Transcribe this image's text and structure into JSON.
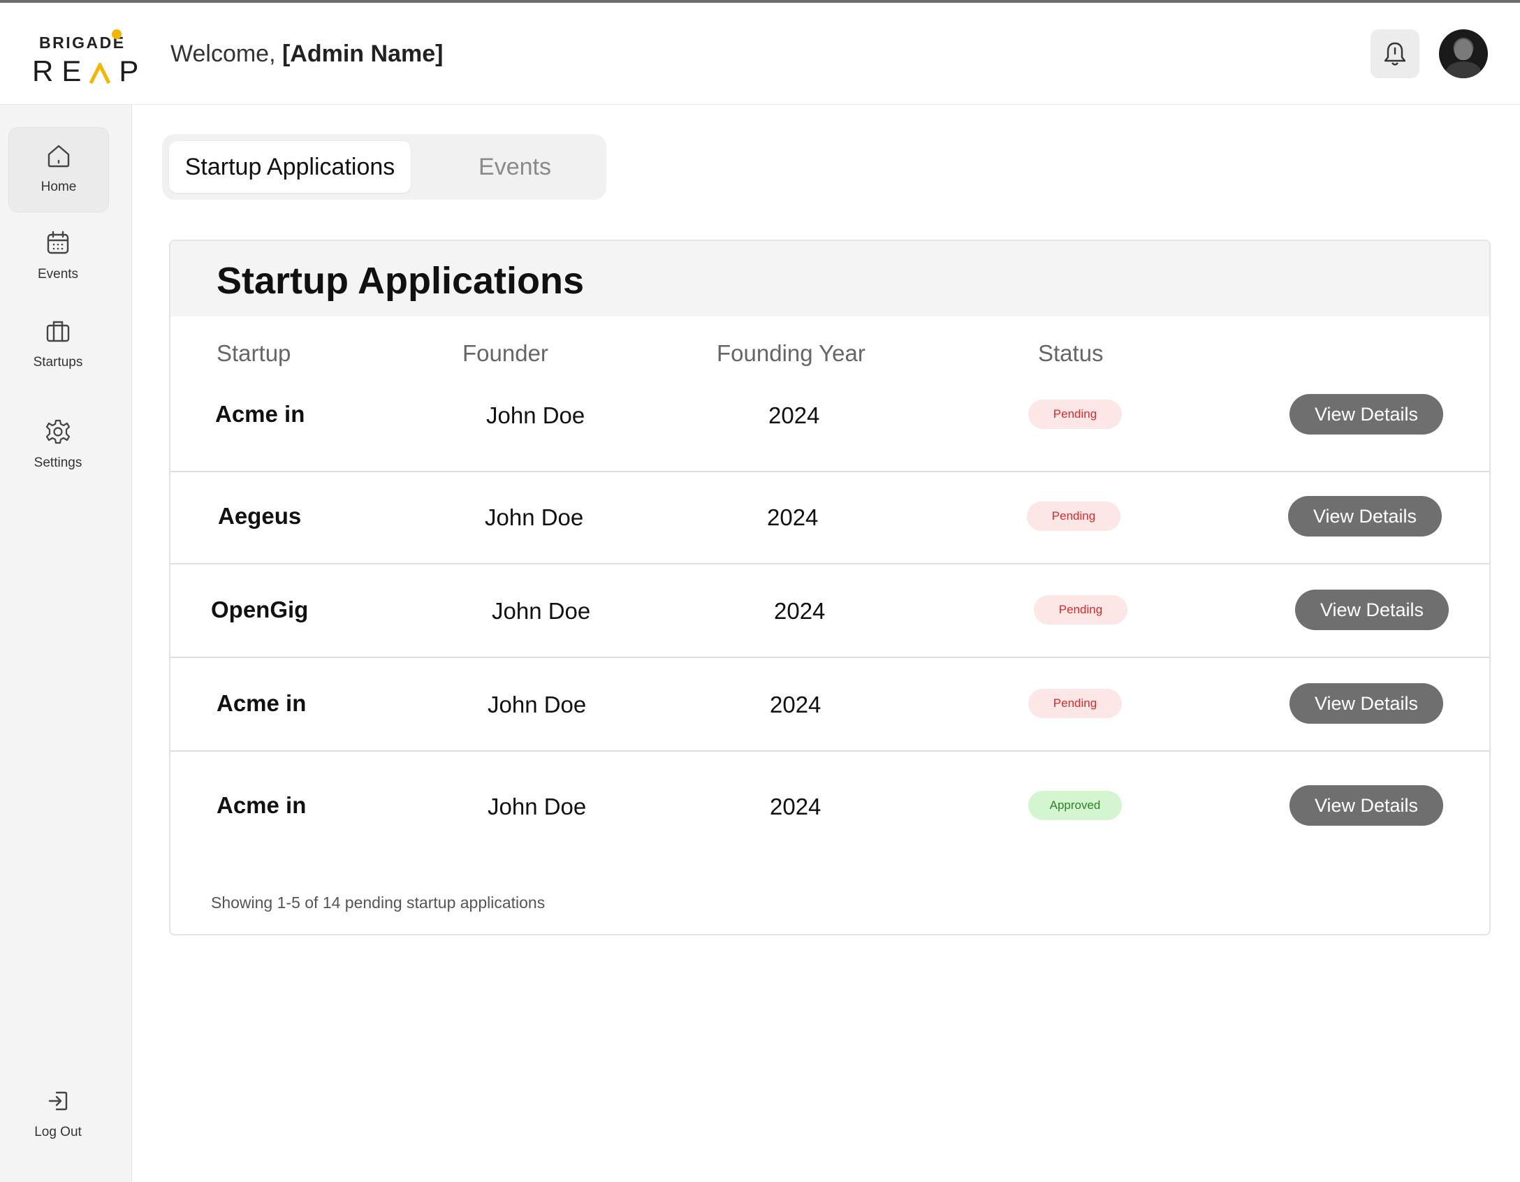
{
  "header": {
    "logo_top": "BRIGADE",
    "logo_bottom": [
      "R",
      "E",
      "P"
    ],
    "welcome_prefix": "Welcome,",
    "admin_name": "[Admin Name]",
    "icons": {
      "notifications": "bell-icon",
      "profile": "avatar"
    },
    "accent_color": "#f5b400"
  },
  "sidebar": {
    "items": [
      {
        "label": "Home",
        "icon": "home-icon",
        "active": true
      },
      {
        "label": "Events",
        "icon": "calendar-icon",
        "active": false
      },
      {
        "label": "Startups",
        "icon": "briefcase-icon",
        "active": false
      },
      {
        "label": "Settings",
        "icon": "gear-icon",
        "active": false
      }
    ],
    "logout_label": "Log Out",
    "logout_icon": "logout-icon"
  },
  "tabs": [
    {
      "label": "Startup Applications",
      "active": true
    },
    {
      "label": "Events",
      "active": false
    }
  ],
  "card": {
    "title": "Startup Applications",
    "columns": [
      "Startup",
      "Founder",
      "Founding Year",
      "Status"
    ],
    "rows": [
      {
        "startup": "Acme in",
        "founder": "John Doe",
        "year": "2024",
        "status": "Pending",
        "action": "View Details"
      },
      {
        "startup": "Aegeus",
        "founder": "John Doe",
        "year": "2024",
        "status": "Pending",
        "action": "View Details"
      },
      {
        "startup": "OpenGig",
        "founder": "John Doe",
        "year": "2024",
        "status": "Pending",
        "action": "View Details"
      },
      {
        "startup": "Acme in",
        "founder": "John Doe",
        "year": "2024",
        "status": "Pending",
        "action": "View Details"
      },
      {
        "startup": "Acme in",
        "founder": "John Doe",
        "year": "2024",
        "status": "Approved",
        "action": "View Details"
      }
    ],
    "footer": "Showing 1-5 of 14 pending startup applications",
    "status_colors": {
      "pending_bg": "#fce6e6",
      "pending_text": "#d62b2b",
      "approved_bg": "#d3f5cf",
      "approved_text": "#2f7f2a"
    }
  }
}
